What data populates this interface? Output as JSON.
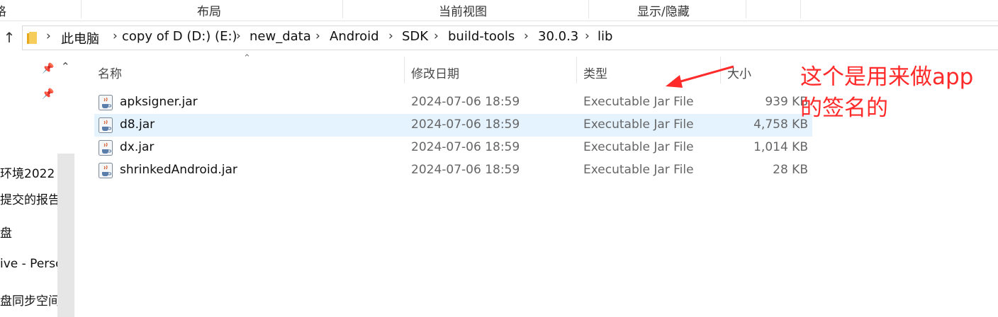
{
  "ribbon": {
    "items": [
      {
        "label": "格"
      },
      {
        "label": "布局"
      },
      {
        "label": "当前视图"
      },
      {
        "label": "显示/隐藏"
      }
    ]
  },
  "address_bar": {
    "crumbs": [
      "此电脑",
      "copy of D (D:) (E:)",
      "new_data",
      "Android",
      "SDK",
      "build-tools",
      "30.0.3",
      "lib"
    ]
  },
  "nav_pane": {
    "items": [
      {
        "label": "环境2022"
      },
      {
        "label": "提交的报告和"
      },
      {
        "label": "盘"
      },
      {
        "label": "ive - Perso"
      },
      {
        "label": "盘同步空间"
      }
    ]
  },
  "columns": {
    "name": "名称",
    "modified": "修改日期",
    "type": "类型",
    "size": "大小"
  },
  "files": [
    {
      "name": "apksigner.jar",
      "modified": "2024-07-06 18:59",
      "type": "Executable Jar File",
      "size": "939 KB",
      "selected": false
    },
    {
      "name": "d8.jar",
      "modified": "2024-07-06 18:59",
      "type": "Executable Jar File",
      "size": "4,758 KB",
      "selected": true
    },
    {
      "name": "dx.jar",
      "modified": "2024-07-06 18:59",
      "type": "Executable Jar File",
      "size": "1,014 KB",
      "selected": false
    },
    {
      "name": "shrinkedAndroid.jar",
      "modified": "2024-07-06 18:59",
      "type": "Executable Jar File",
      "size": "28 KB",
      "selected": false
    }
  ],
  "annotation": {
    "text": "这个是用来做app的签名的",
    "color": "#ff2a2a"
  },
  "colors": {
    "selection": "#e5f3ff",
    "folder": "#f2c14e"
  }
}
